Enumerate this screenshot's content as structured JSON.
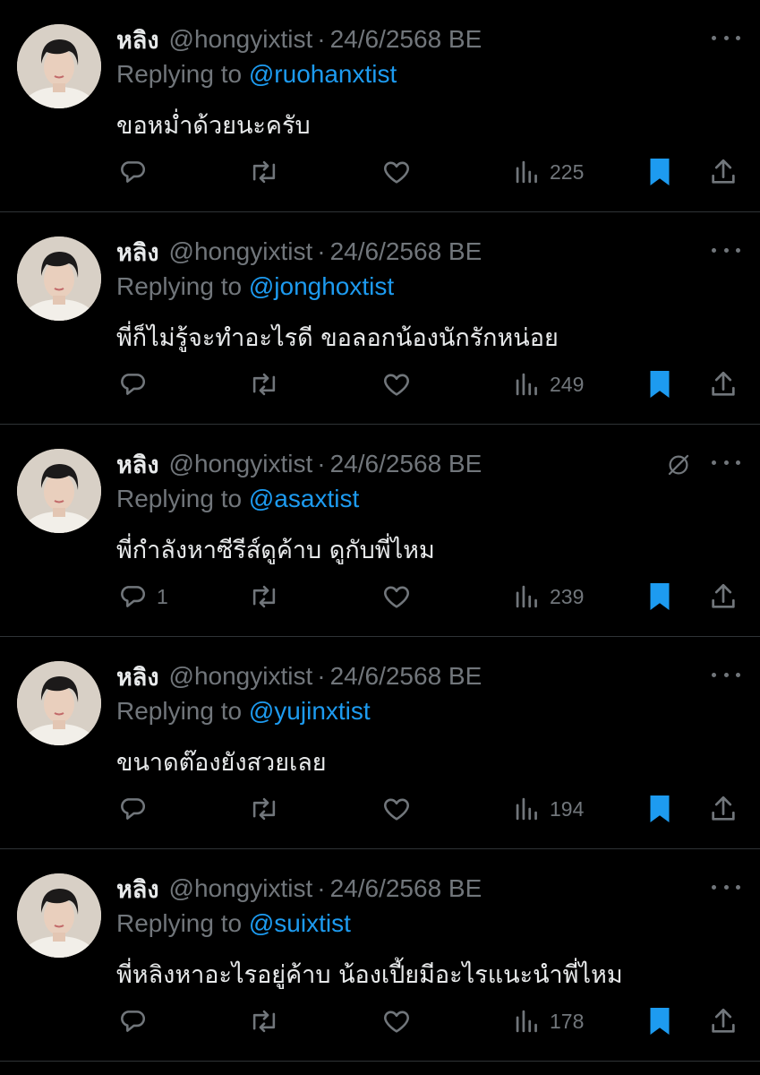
{
  "colors": {
    "background": "#000000",
    "text_primary": "#e7e9ea",
    "text_secondary": "#71767b",
    "accent": "#1d9bf0",
    "divider": "#2f3336"
  },
  "icons": {
    "reply": "speech-bubble",
    "retweet": "loop-arrows",
    "like": "heart-outline",
    "views": "bar-chart",
    "bookmark": "bookmark-filled",
    "share": "upload-arrow",
    "more": "three-dots",
    "grok": "circle-slash"
  },
  "tweets": [
    {
      "display_name": "หลิง",
      "handle": "@hongyixtist",
      "separator": "·",
      "timestamp": "24/6/2568 BE",
      "replying_prefix": "Replying to",
      "replying_to": "@ruohanxtist",
      "text": "ขอหม่ำด้วยนะครับ",
      "reply_count": "",
      "views": "225",
      "bookmarked": true
    },
    {
      "display_name": "หลิง",
      "handle": "@hongyixtist",
      "separator": "·",
      "timestamp": "24/6/2568 BE",
      "replying_prefix": "Replying to",
      "replying_to": "@jonghoxtist",
      "text": "พี่ก็ไม่รู้จะทำอะไรดี ขอลอกน้องนักรักหน่อย",
      "reply_count": "",
      "views": "249",
      "bookmarked": true
    },
    {
      "display_name": "หลิง",
      "handle": "@hongyixtist",
      "separator": "·",
      "timestamp": "24/6/2568 BE",
      "replying_prefix": "Replying to",
      "replying_to": "@asaxtist",
      "text": "พี่กำลังหาซีรีส์ดูค้าบ ดูกับพี่ไหม",
      "reply_count": "1",
      "views": "239",
      "bookmarked": true
    },
    {
      "display_name": "หลิง",
      "handle": "@hongyixtist",
      "separator": "·",
      "timestamp": "24/6/2568 BE",
      "replying_prefix": "Replying to",
      "replying_to": "@yujinxtist",
      "text": "ขนาดต๊องยังสวยเลย",
      "reply_count": "",
      "views": "194",
      "bookmarked": true
    },
    {
      "display_name": "หลิง",
      "handle": "@hongyixtist",
      "separator": "·",
      "timestamp": "24/6/2568 BE",
      "replying_prefix": "Replying to",
      "replying_to": "@suixtist",
      "text": "พี่หลิงหาอะไรอยู่ค้าบ น้องเปี้ยมีอะไรแนะนำพี่ไหม",
      "reply_count": "",
      "views": "178",
      "bookmarked": true
    }
  ]
}
